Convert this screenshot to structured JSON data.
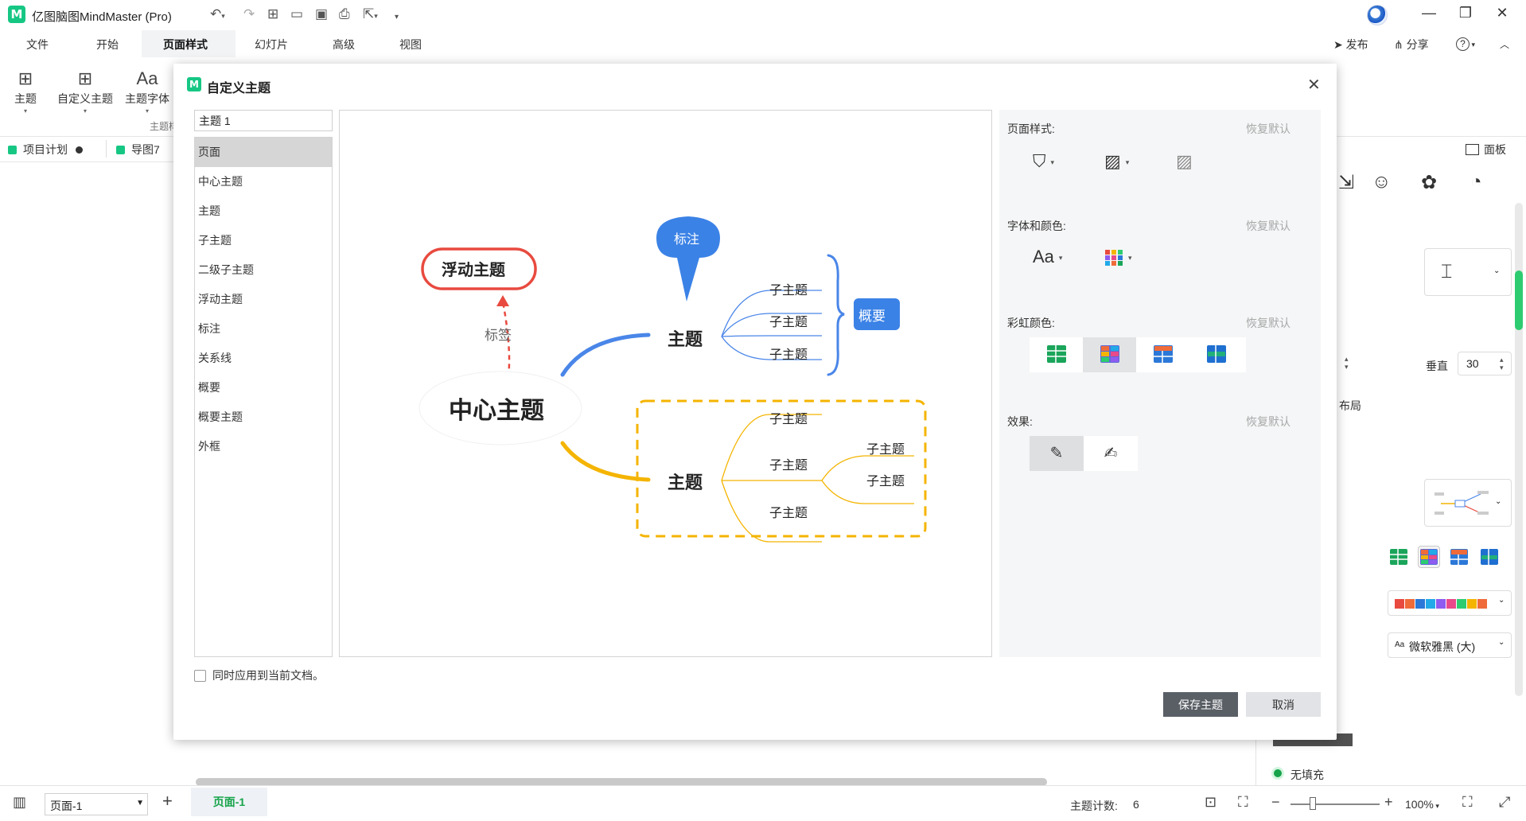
{
  "app": {
    "title": "亿图脑图MindMaster (Pro)",
    "logo_glyph": "M",
    "accent_color": "#16c784"
  },
  "menu": {
    "tabs": [
      "文件",
      "开始",
      "页面样式",
      "幻灯片",
      "高级",
      "视图"
    ],
    "active_tab": "页面样式",
    "publish": "发布",
    "share": "分享",
    "help_glyph": "?"
  },
  "ribbon": {
    "theme": "主题",
    "custom_theme": "自定义主题",
    "theme_font": "主题字体",
    "group_label": "主题样"
  },
  "doc_tabs": [
    "项目计划",
    "导图7"
  ],
  "right_panel": {
    "panel_label": "面板",
    "vertical_label": "垂直",
    "vertical_value": "30",
    "layout_label": "布局",
    "font_value": "微软雅黑 (大)",
    "font_prefix": "Aa",
    "no_fill": "无填充"
  },
  "status": {
    "page_select": "页面-1",
    "page_tab": "页面-1",
    "topic_count_label": "主题计数:",
    "topic_count": "6",
    "zoom": "100%"
  },
  "dialog": {
    "title": "自定义主题",
    "theme_name": "主题 1",
    "categories": [
      "页面",
      "中心主题",
      "主题",
      "子主题",
      "二级子主题",
      "浮动主题",
      "标注",
      "关系线",
      "概要",
      "概要主题",
      "外框"
    ],
    "selected_category": "页面",
    "settings": {
      "page_style": "页面样式:",
      "font_color": "字体和颜色:",
      "rainbow": "彩虹颜色:",
      "effect": "效果:",
      "reset": "恢复默认",
      "font_glyph": "Aa"
    },
    "apply_to_current": "同时应用到当前文档。",
    "save": "保存主题",
    "cancel": "取消"
  },
  "mindmap": {
    "central": "中心主题",
    "floating": "浮动主题",
    "relation_label": "标签",
    "callout": "标注",
    "summary": "概要",
    "topic_top": "主题",
    "topic_bottom": "主题",
    "subtopics_top": [
      "子主题",
      "子主题",
      "子主题"
    ],
    "subtopics_bottom": [
      "子主题",
      "子主题",
      "子主题"
    ],
    "level2_subtopics": [
      "子主题",
      "子主题"
    ],
    "colors": {
      "floating_border": "#e84a3f",
      "blue": "#4a86e8",
      "yellow": "#f4b400",
      "callout_bg": "#3b82e6",
      "summary_bg": "#3b82e6"
    }
  }
}
